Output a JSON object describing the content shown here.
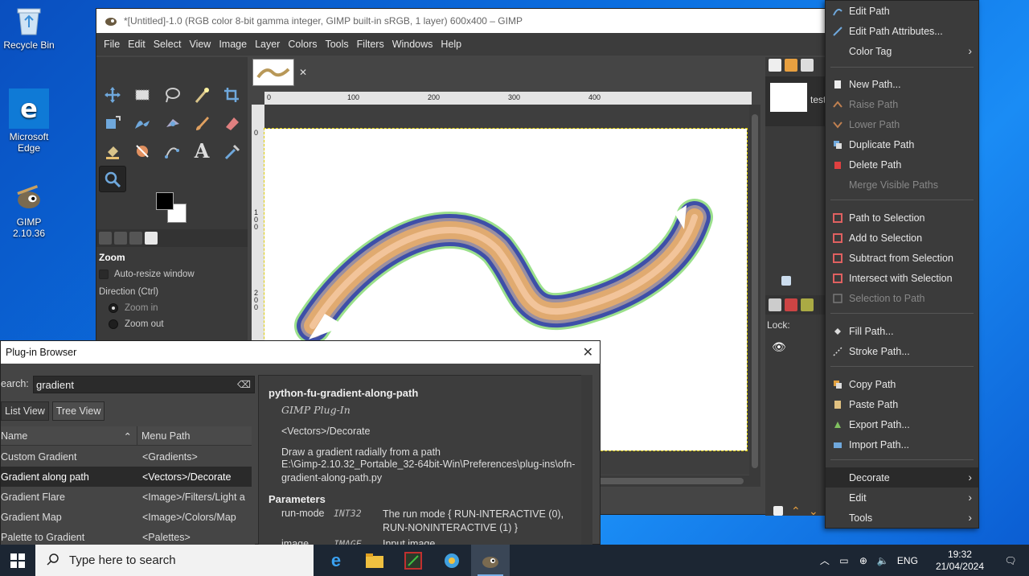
{
  "desktop": {
    "icons": [
      {
        "label": "Recycle Bin",
        "icon": "recycle-bin-icon"
      },
      {
        "label": "Microsoft Edge",
        "icon": "edge-icon"
      },
      {
        "label": "GIMP 2.10.36",
        "icon": "gimp-icon"
      }
    ]
  },
  "gimp": {
    "title": "*[Untitled]-1.0 (RGB color 8-bit gamma integer, GIMP built-in sRGB, 1 layer) 600x400 – GIMP",
    "menu": [
      "File",
      "Edit",
      "Select",
      "View",
      "Image",
      "Layer",
      "Colors",
      "Tools",
      "Filters",
      "Windows",
      "Help"
    ],
    "tool_options": {
      "heading": "Zoom",
      "auto_resize": "Auto-resize window",
      "direction_label": "Direction  (Ctrl)",
      "zoom_in": "Zoom in",
      "zoom_out": "Zoom out"
    },
    "ruler_h": [
      "0",
      "100",
      "200",
      "300",
      "400"
    ],
    "ruler_v": [
      "0",
      "100",
      "200"
    ],
    "layer_name": "test",
    "lock_label": "Lock:"
  },
  "context_menu": {
    "items": [
      {
        "label": "Edit Path",
        "icon": "path-edit-icon",
        "enabled": true
      },
      {
        "label": "Edit Path Attributes...",
        "icon": "pencil-icon",
        "enabled": true
      },
      {
        "label": "Color Tag",
        "icon": "",
        "enabled": true,
        "submenu": true
      },
      {
        "label": "New Path...",
        "icon": "new-page-icon",
        "enabled": true
      },
      {
        "label": "Raise Path",
        "icon": "raise-icon",
        "enabled": false
      },
      {
        "label": "Lower Path",
        "icon": "lower-icon",
        "enabled": false
      },
      {
        "label": "Duplicate Path",
        "icon": "duplicate-icon",
        "enabled": true
      },
      {
        "label": "Delete Path",
        "icon": "delete-icon",
        "enabled": true
      },
      {
        "label": "Merge Visible Paths",
        "icon": "",
        "enabled": false
      },
      {
        "label": "Path to Selection",
        "icon": "path-to-selection-icon",
        "enabled": true
      },
      {
        "label": "Add to Selection",
        "icon": "add-selection-icon",
        "enabled": true
      },
      {
        "label": "Subtract from Selection",
        "icon": "subtract-selection-icon",
        "enabled": true
      },
      {
        "label": "Intersect with Selection",
        "icon": "intersect-selection-icon",
        "enabled": true
      },
      {
        "label": "Selection to Path",
        "icon": "selection-to-path-icon",
        "enabled": false
      },
      {
        "label": "Fill Path...",
        "icon": "fill-icon",
        "enabled": true
      },
      {
        "label": "Stroke Path...",
        "icon": "stroke-icon",
        "enabled": true
      },
      {
        "label": "Copy Path",
        "icon": "copy-icon",
        "enabled": true
      },
      {
        "label": "Paste Path",
        "icon": "paste-icon",
        "enabled": true
      },
      {
        "label": "Export Path...",
        "icon": "export-icon",
        "enabled": true
      },
      {
        "label": "Import Path...",
        "icon": "import-icon",
        "enabled": true
      },
      {
        "label": "Decorate",
        "icon": "",
        "enabled": true,
        "submenu": true
      },
      {
        "label": "Edit",
        "icon": "",
        "enabled": true,
        "submenu": true
      },
      {
        "label": "Tools",
        "icon": "",
        "enabled": true,
        "submenu": true
      }
    ]
  },
  "plugin_browser": {
    "title": "Plug-in Browser",
    "search_label": "earch:",
    "search_value": "gradient",
    "tabs": [
      "List View",
      "Tree View"
    ],
    "columns": [
      "Name",
      "Menu Path"
    ],
    "rows": [
      {
        "name": "Custom Gradient",
        "path": "<Gradients>"
      },
      {
        "name": "Gradient along path",
        "path": "<Vectors>/Decorate"
      },
      {
        "name": "Gradient Flare",
        "path": "<Image>/Filters/Light a"
      },
      {
        "name": "Gradient Map",
        "path": "<Image>/Colors/Map"
      },
      {
        "name": "Palette to Gradient",
        "path": "<Palettes>"
      }
    ],
    "detail": {
      "name": "python-fu-gradient-along-path",
      "type": "GIMP Plug-In",
      "menu_path": "<Vectors>/Decorate",
      "blurb": "Draw a gradient radially from a path",
      "file_path": "E:\\Gimp-2.10.32_Portable_32-64bit-Win\\Preferences\\plug-ins\\ofn-gradient-along-path.py",
      "params_heading": "Parameters",
      "params": [
        {
          "name": "run-mode",
          "type": "INT32",
          "desc": "The run mode { RUN-INTERACTIVE (0), RUN-NONINTERACTIVE (1) }"
        },
        {
          "name": "image",
          "type": "IMAGE",
          "desc": "Input image"
        }
      ]
    }
  },
  "taskbar": {
    "search_placeholder": "Type here to search",
    "language": "ENG",
    "time": "19:32",
    "date": "21/04/2024"
  }
}
